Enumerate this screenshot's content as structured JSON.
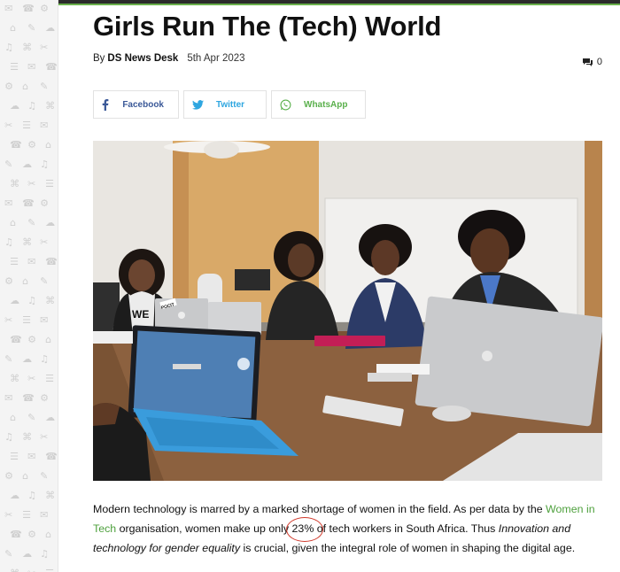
{
  "article": {
    "title": "Girls Run The (Tech) World",
    "by_label": "By",
    "author": "DS News Desk",
    "date": "5th Apr 2023",
    "comment_count": "0"
  },
  "share": {
    "facebook": "Facebook",
    "twitter": "Twitter",
    "whatsapp": "WhatsApp"
  },
  "photo": {
    "shirt_text": "WE",
    "sticker_text": "POCIT"
  },
  "body": {
    "p1": "Modern technology is marred by a marked shortage of women in the field. As per data by the ",
    "link": "Women in Tech",
    "p2": " organisation, women make up only ",
    "stat": "23%",
    "p3": " of tech workers in South Africa. Thus ",
    "em": "Innovation and technology for gender equality",
    "p4": " is crucial, given the integral role of women in shaping the digital age."
  },
  "colors": {
    "accent_green": "#6ab04c",
    "link_green": "#4fa13e",
    "highlight_red": "#d0392b"
  },
  "icons": {
    "comment": "comment-icon",
    "facebook": "facebook-icon",
    "twitter": "twitter-icon",
    "whatsapp": "whatsapp-icon"
  }
}
